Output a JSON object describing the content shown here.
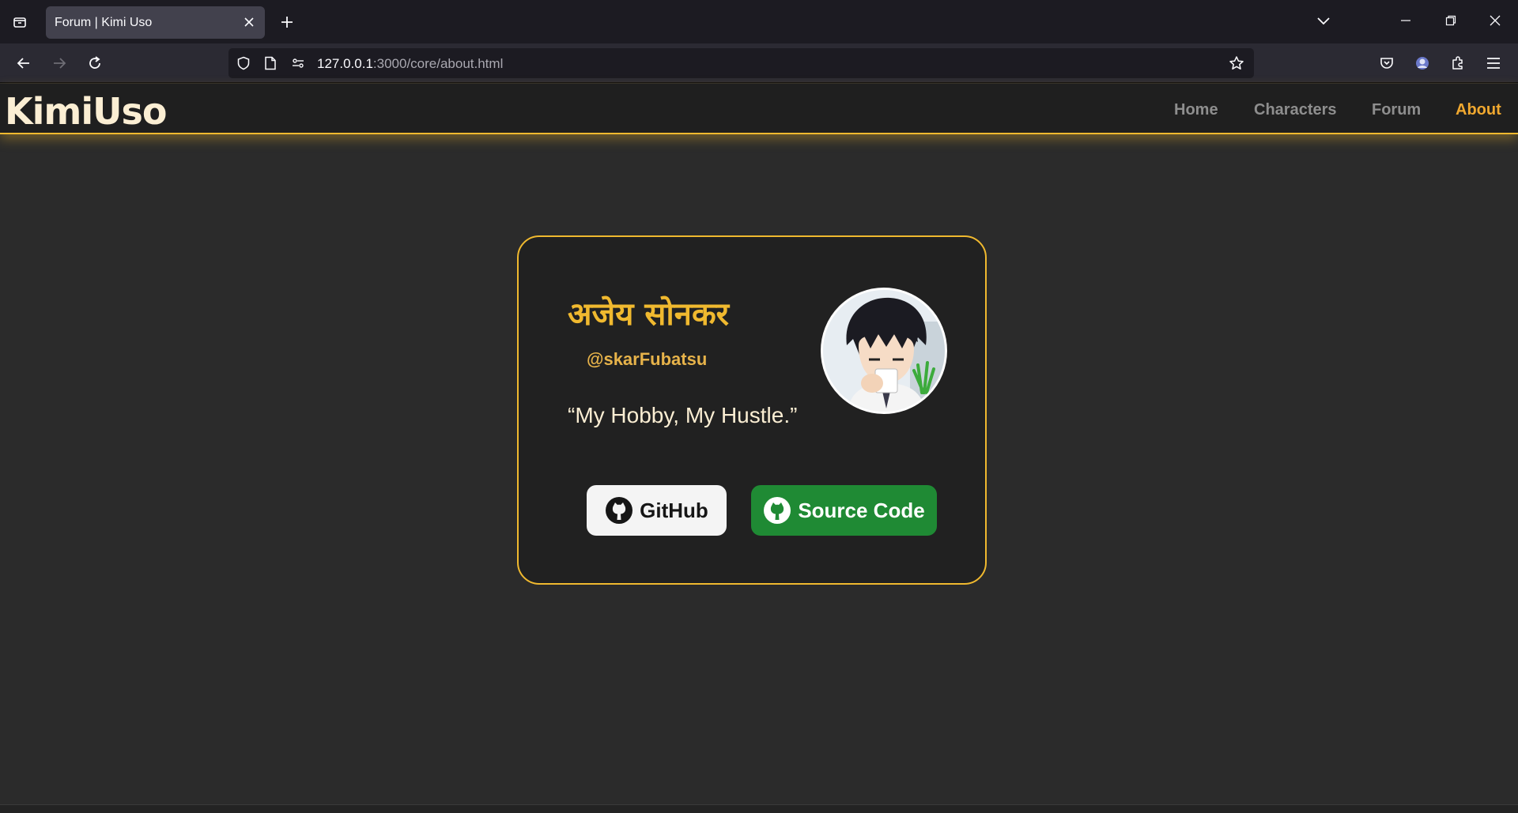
{
  "browser": {
    "tab_title": "Forum | Kimi Uso",
    "url_host": "127.0.0.1",
    "url_path": ":3000/core/about.html"
  },
  "site": {
    "brand": "KimiUso",
    "menu": [
      {
        "label": "Home",
        "active": false
      },
      {
        "label": "Characters",
        "active": false
      },
      {
        "label": "Forum",
        "active": false
      },
      {
        "label": "About",
        "active": true
      }
    ]
  },
  "profile": {
    "name": "अजेय सोनकर",
    "handle": "@skarFubatsu",
    "quote": "“My Hobby, My Hustle.”",
    "buttons": {
      "github": "GitHub",
      "source": "Source Code"
    }
  },
  "colors": {
    "accent": "#f0b92f",
    "active_nav": "#f0a82f",
    "github_btn": "#f4f4f4",
    "source_btn": "#1f8a34"
  }
}
